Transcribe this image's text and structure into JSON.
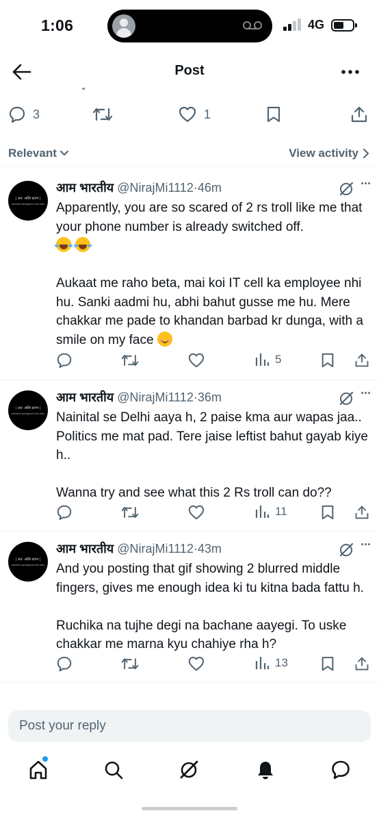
{
  "status_bar": {
    "time": "1:06",
    "network": "4G"
  },
  "header": {
    "title": "Post"
  },
  "post_actions": {
    "replies": "3",
    "reposts": "",
    "likes": "1"
  },
  "sortbar": {
    "relevant": "Relevant",
    "view_activity": "View activity"
  },
  "replies": [
    {
      "display_name": "आम भारतीय",
      "handle": "@NirajMi1112",
      "separator": "·",
      "time": "46m",
      "avatar_text_1": "| अंत: अस्ति प्रारंभ |",
      "avatar_text_2": "sarvbhut aarshganch shar datn",
      "paragraphs": [
        "Apparently, you are so scared of 2 rs troll like me that your phone number is already switched off.",
        "Aukaat me raho beta, mai koi IT cell ka employee nhi hu. Sanki aadmi hu, abhi bahut gusse me hu. Mere chakkar me pade to khandan barbad kr dunga, with a smile on my face"
      ],
      "views": "5"
    },
    {
      "display_name": "आम भारतीय",
      "handle": "@NirajMi1112",
      "separator": "·",
      "time": "36m",
      "avatar_text_1": "| अंत: अस्ति प्रारंभ |",
      "avatar_text_2": "sarvbhut aarshganch shar datn",
      "paragraphs": [
        "Nainital se Delhi aaya h, 2 paise kma aur wapas jaa.. Politics me mat pad. Tere jaise leftist bahut gayab kiye h..",
        "Wanna try and see what this 2 Rs troll can do??"
      ],
      "views": "11"
    },
    {
      "display_name": "आम भारतीय",
      "handle": "@NirajMi1112",
      "separator": "·",
      "time": "43m",
      "avatar_text_1": "| अंत: अस्ति प्रारंभ |",
      "avatar_text_2": "sarvbhut aarshganch shar datn",
      "paragraphs": [
        "And you posting that gif showing 2 blurred middle fingers, gives me enough idea ki tu kitna bada fattu h.",
        "Ruchika na tujhe degi na bachane aayegi. To uske chakkar me marna kyu chahiye rha h?"
      ],
      "views": "13"
    }
  ],
  "composer": {
    "placeholder": "Post your reply"
  },
  "icons": {
    "back": "arrow-left-icon",
    "more": "more-horizontal-icon",
    "reply": "comment-icon",
    "repost": "repost-icon",
    "like": "heart-icon",
    "bookmark": "bookmark-icon",
    "share": "share-icon",
    "views": "bar-chart-icon",
    "grok": "grok-icon",
    "nav": [
      "home-icon",
      "search-icon",
      "grok-icon",
      "bell-icon",
      "messages-icon"
    ]
  },
  "colors": {
    "text": "#0f1419",
    "secondary": "#536471",
    "accent": "#1d9bf0",
    "divider": "#eff3f4"
  }
}
